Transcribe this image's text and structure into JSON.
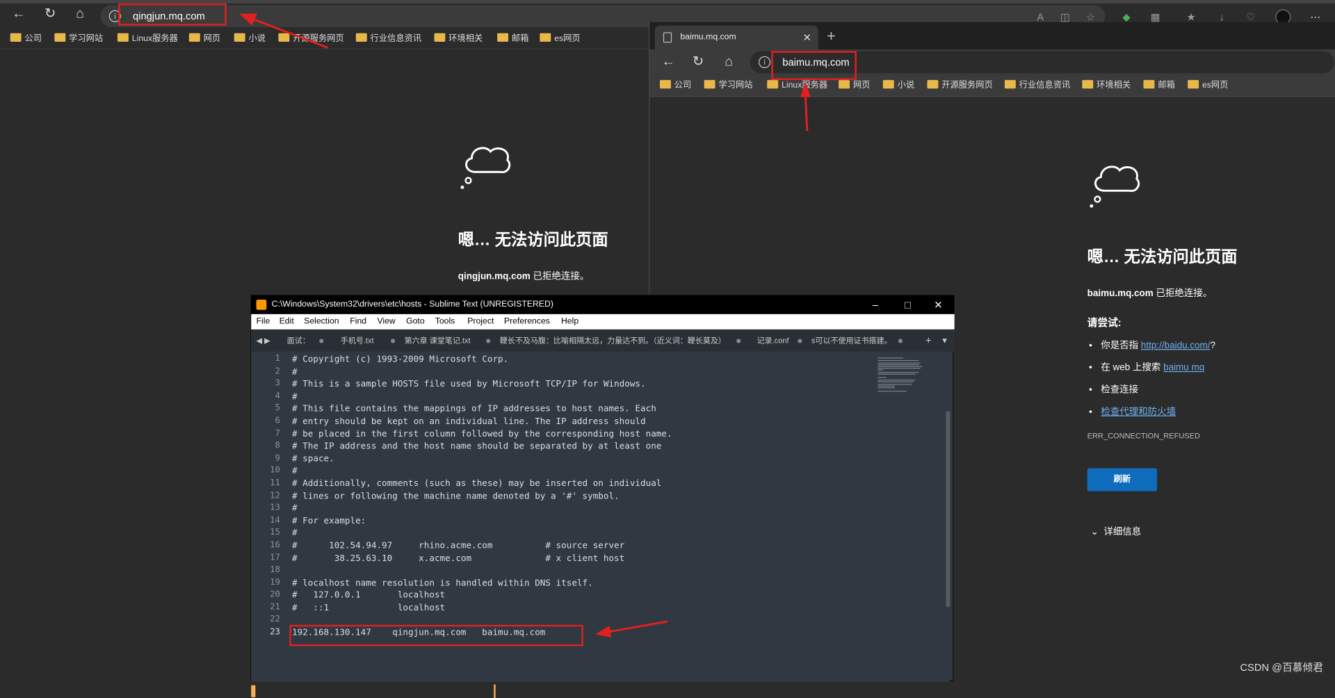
{
  "left_browser": {
    "url": "qingjun.mq.com",
    "bookmarks": [
      "公司",
      "学习网站",
      "Linux服务器",
      "网页",
      "小说",
      "开源服务网页",
      "行业信息资讯",
      "环境相关",
      "邮箱",
      "es网页"
    ],
    "error_title": "嗯… 无法访问此页面",
    "error_host": "qingjun.mq.com",
    "error_msg": "已拒绝连接。"
  },
  "right_browser": {
    "tab_title": "baimu.mq.com",
    "url": "baimu.mq.com",
    "bookmarks": [
      "公司",
      "学习网站",
      "Linux服务器",
      "网页",
      "小说",
      "开源服务网页",
      "行业信息资讯",
      "环境相关",
      "邮箱",
      "es网页"
    ],
    "error_title": "嗯… 无法访问此页面",
    "error_host": "baimu.mq.com",
    "error_msg": "已拒绝连接。",
    "try_label": "请尝试:",
    "suggestion1_pre": "你是否指",
    "suggestion1_link": "http://baidu.com/",
    "suggestion1_post": "?",
    "suggestion2_pre": "在 web 上搜索",
    "suggestion2_link": "baimu mq",
    "suggestion3": "检查连接",
    "suggestion4_link": "检查代理和防火墙",
    "error_code": "ERR_CONNECTION_REFUSED",
    "refresh_label": "刷新",
    "details_label": "详细信息"
  },
  "sublime": {
    "title": "C:\\Windows\\System32\\drivers\\etc\\hosts - Sublime Text (UNREGISTERED)",
    "menu": [
      "File",
      "Edit",
      "Selection",
      "Find",
      "View",
      "Goto",
      "Tools",
      "Project",
      "Preferences",
      "Help"
    ],
    "tabs": [
      "面试：",
      "手机号.txt",
      "第六章 课堂笔记.txt",
      "鞭长不及马腹：比喻相隔太远，力量达不到。（近义词：鞭长莫及）",
      "记录.conf",
      "s可以不使用证书搭建。"
    ],
    "lines": [
      "# Copyright (c) 1993-2009 Microsoft Corp.",
      "#",
      "# This is a sample HOSTS file used by Microsoft TCP/IP for Windows.",
      "#",
      "# This file contains the mappings of IP addresses to host names. Each",
      "# entry should be kept on an individual line. The IP address should",
      "# be placed in the first column followed by the corresponding host name.",
      "# The IP address and the host name should be separated by at least one",
      "# space.",
      "#",
      "# Additionally, comments (such as these) may be inserted on individual",
      "# lines or following the machine name denoted by a '#' symbol.",
      "#",
      "# For example:",
      "#",
      "#      102.54.94.97     rhino.acme.com          # source server",
      "#       38.25.63.10     x.acme.com              # x client host",
      "",
      "# localhost name resolution is handled within DNS itself.",
      "#   127.0.0.1       localhost",
      "#   ::1             localhost",
      "",
      "192.168.130.147    qingjun.mq.com   baimu.mq.com"
    ],
    "line_numbers": [
      "1",
      "2",
      "3",
      "4",
      "5",
      "6",
      "7",
      "8",
      "9",
      "10",
      "11",
      "12",
      "13",
      "14",
      "15",
      "16",
      "17",
      "18",
      "19",
      "20",
      "21",
      "22",
      "23"
    ]
  },
  "watermark": "CSDN @百慕倾君"
}
